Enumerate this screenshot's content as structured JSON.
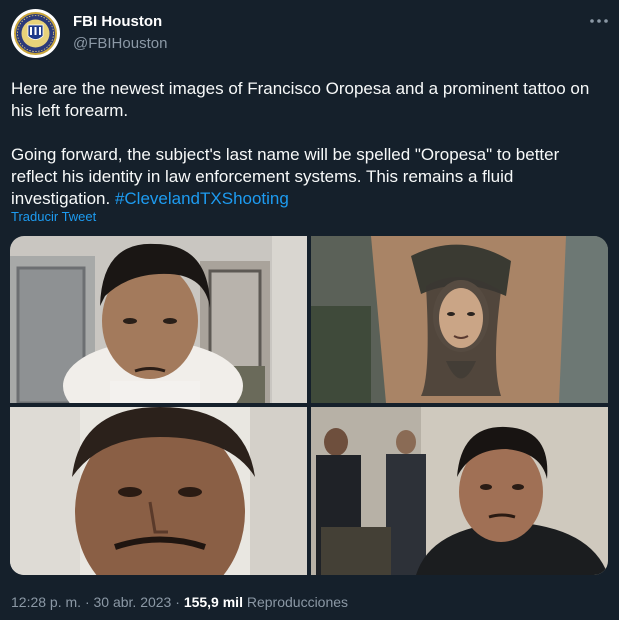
{
  "account": {
    "display_name": "FBI Houston",
    "handle": "@FBIHouston",
    "avatar_icon": "fbi-seal-icon"
  },
  "more_icon": "more-horizontal-icon",
  "tweet": {
    "paragraph_1": "Here are the newest images of Francisco Oropesa and a prominent tattoo on his left forearm.",
    "paragraph_2": "Going forward, the subject's last name will be spelled \"Oropesa\" to better reflect his identity in law enforcement systems. This remains a fluid investigation. ",
    "hashtag": "#ClevelandTXShooting",
    "translate_label": "Traducir Tweet"
  },
  "media": [
    {
      "name": "photo-suspect-office"
    },
    {
      "name": "photo-forearm-tattoo"
    },
    {
      "name": "photo-suspect-closeup"
    },
    {
      "name": "photo-suspect-room"
    }
  ],
  "meta": {
    "time": "12:28 p. m.",
    "separator": "·",
    "date": "30 abr. 2023",
    "views_count": "155,9 mil",
    "views_label": "Reproducciones"
  },
  "colors": {
    "background": "#15202b",
    "text": "#f7f9f9",
    "secondary": "#8b98a5",
    "link": "#1d9bf0"
  }
}
